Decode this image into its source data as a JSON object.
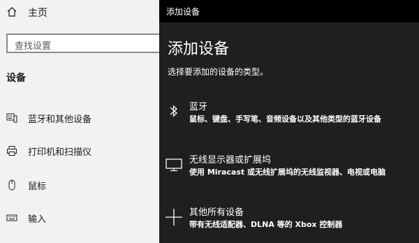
{
  "left_pane": {
    "home_label": "主页",
    "search_placeholder": "查找设置",
    "section_title": "设备",
    "nav_items": [
      {
        "label": "蓝牙和其他设备",
        "icon": "keyboard-phone-icon"
      },
      {
        "label": "打印机和扫描仪",
        "icon": "printer-icon"
      },
      {
        "label": "鼠标",
        "icon": "mouse-icon"
      },
      {
        "label": "输入",
        "icon": "keyboard-icon"
      }
    ]
  },
  "dialog": {
    "window_title": "添加设备",
    "heading": "添加设备",
    "subtitle": "选择要添加的设备的类型。",
    "options": [
      {
        "name": "蓝牙",
        "description": "鼠标、键盘、手写笔、音频设备以及其他类型的蓝牙设备",
        "icon": "bluetooth-icon"
      },
      {
        "name": "无线显示器或扩展坞",
        "description": "使用 Miracast 或无线扩展坞的无线监视器、电视或电脑",
        "icon": "monitor-icon"
      },
      {
        "name": "其他所有设备",
        "description": "带有无线适配器、DLNA 等的 Xbox 控制器",
        "icon": "plus-icon"
      }
    ]
  },
  "colors": {
    "left_background": "#f2f2f2",
    "dialog_background": "#1f1f1f",
    "titlebar_background": "#000000",
    "text_dark": "#1a1a1a",
    "text_light": "#ffffff"
  }
}
